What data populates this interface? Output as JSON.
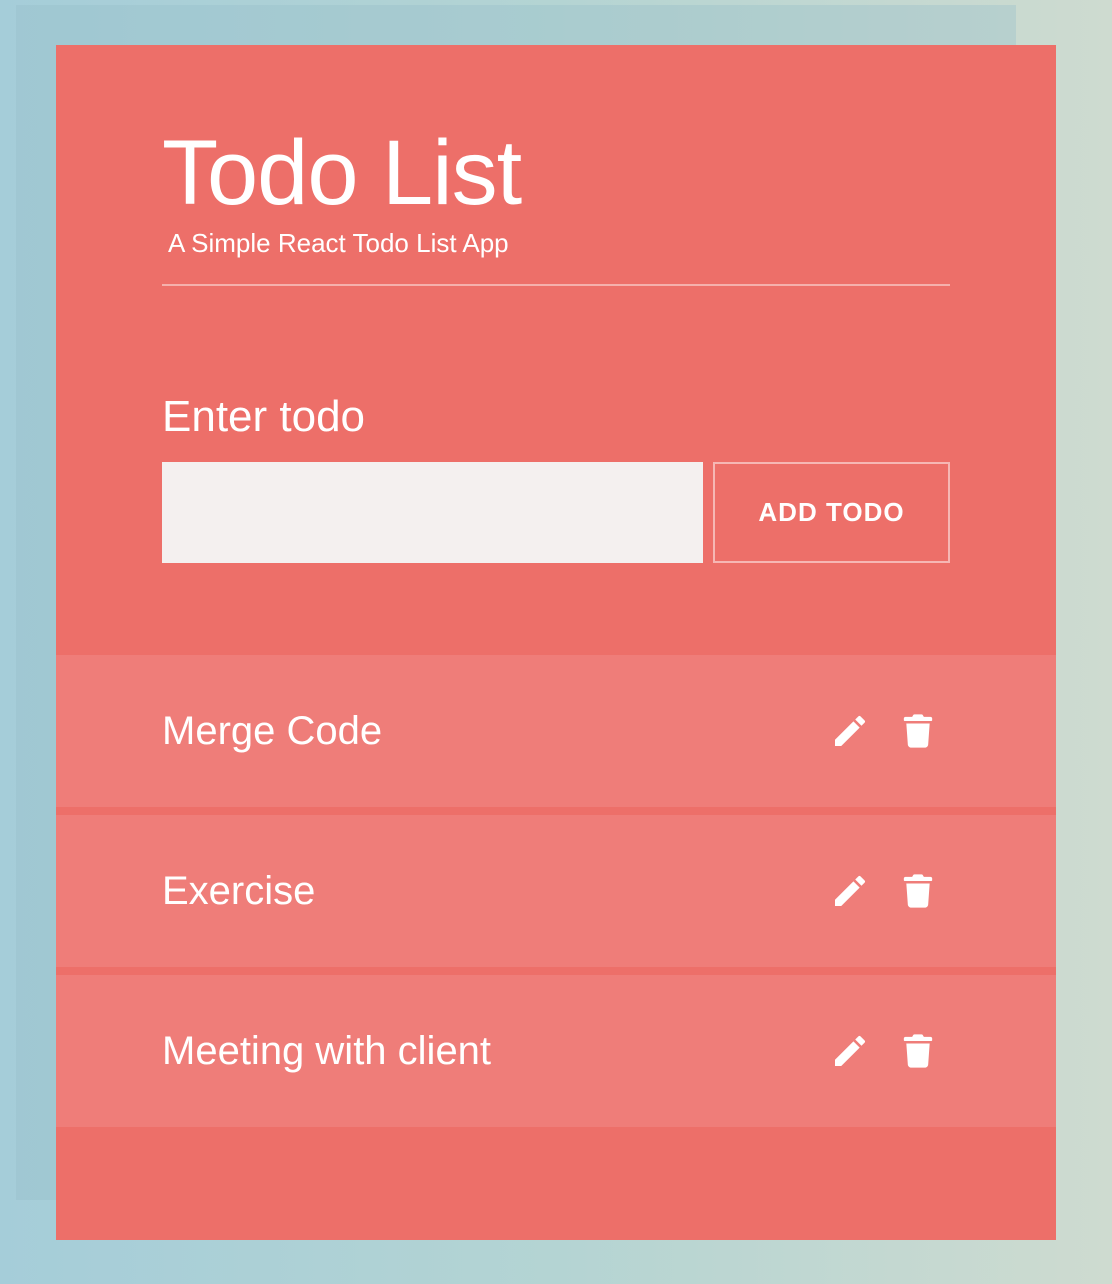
{
  "app": {
    "title": "Todo List",
    "subtitle": "A Simple React Todo List App"
  },
  "form": {
    "label": "Enter todo",
    "input_value": "",
    "input_placeholder": "",
    "add_button_label": "ADD TODO"
  },
  "todos": [
    {
      "text": "Merge Code"
    },
    {
      "text": "Exercise"
    },
    {
      "text": "Meeting with client"
    }
  ],
  "icons": {
    "edit": "pencil-icon",
    "delete": "trash-icon"
  },
  "colors": {
    "card_background": "#ed6f69",
    "todo_item_background": "#ef7d79",
    "input_background": "#f4f0ef",
    "text": "#ffffff"
  }
}
